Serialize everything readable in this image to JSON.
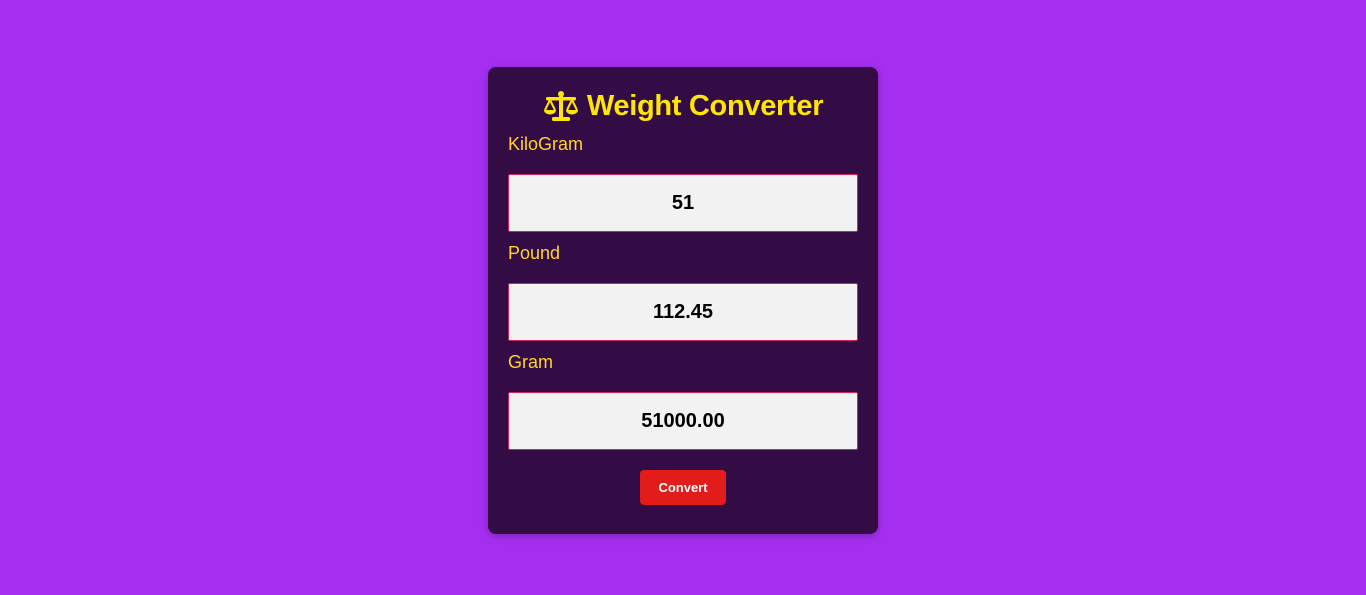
{
  "app": {
    "title": "Weight Converter",
    "title_icon": "scale-balance-icon"
  },
  "colors": {
    "page_background": "#a52ff0",
    "card_background": "#330c45",
    "accent_yellow": "#ffe600",
    "button_red": "#e21b1b",
    "field_border": "#d0245a"
  },
  "fields": {
    "kilogram": {
      "label": "KiloGram",
      "value": "51"
    },
    "pound": {
      "label": "Pound",
      "value": "112.45"
    },
    "gram": {
      "label": "Gram",
      "value": "51000.00"
    }
  },
  "actions": {
    "convert_label": "Convert"
  }
}
